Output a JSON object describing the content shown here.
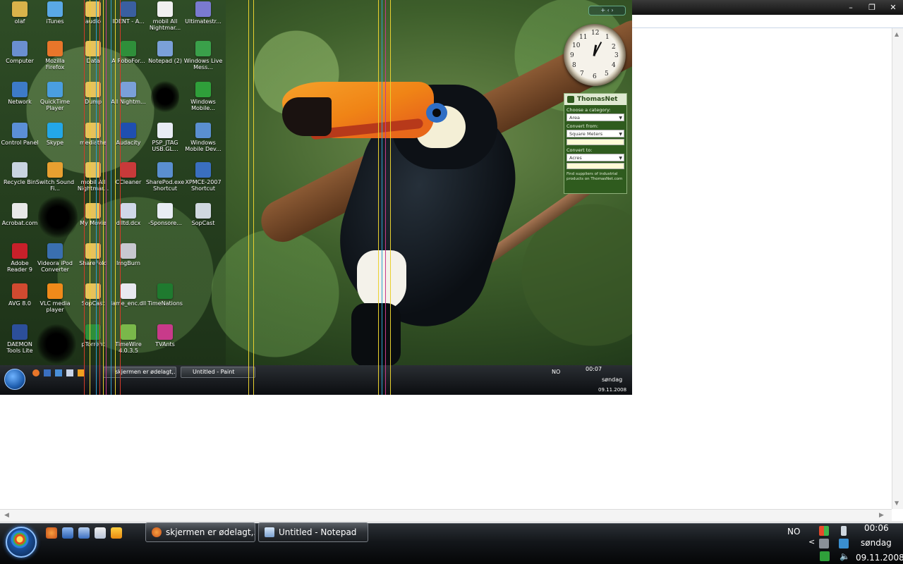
{
  "window": {
    "minimize": "–",
    "maximize": "❐",
    "close": "✕"
  },
  "scrollbars": {
    "up": "▲",
    "down": "▼",
    "left": "◀",
    "right": "▶"
  },
  "screenshot": {
    "icons": [
      {
        "label": "olaf",
        "color": "#d9b34a"
      },
      {
        "label": "iTunes",
        "color": "#5aa9e6"
      },
      {
        "label": "Computer",
        "color": "#6a8fd0"
      },
      {
        "label": "Mozilla Firefox",
        "color": "#e8762a"
      },
      {
        "label": "Network",
        "color": "#3d7bc8"
      },
      {
        "label": "QuickTime Player",
        "color": "#4a9ee0"
      },
      {
        "label": "Control Panel",
        "color": "#5b8fd6"
      },
      {
        "label": "Skype",
        "color": "#23a7e8"
      },
      {
        "label": "Recycle Bin",
        "color": "#c8d4e0"
      },
      {
        "label": "Switch Sound Fi...",
        "color": "#e8a030"
      },
      {
        "label": "Acrobat.com",
        "color": "#e8e8e8"
      },
      {
        "label": "Adobe Reader 9",
        "color": "#c8202a"
      },
      {
        "label": "Videora iPod Converter",
        "color": "#3a6fb0"
      },
      {
        "label": "AVG 8.0",
        "color": "#d04a30"
      },
      {
        "label": "VLC media player",
        "color": "#f08a1a"
      },
      {
        "label": "DAEMON Tools Lite",
        "color": "#2c4f9a"
      },
      {
        "label": "audio",
        "color": "#e8c25a"
      },
      {
        "label": "Data",
        "color": "#e8c25a"
      },
      {
        "label": "Dump",
        "color": "#e8c25a"
      },
      {
        "label": "mediathe",
        "color": "#e8c25a"
      },
      {
        "label": "mobil All Nightmar...",
        "color": "#e8c25a"
      },
      {
        "label": "My Movie",
        "color": "#e8c25a"
      },
      {
        "label": "ShareFold",
        "color": "#e8c25a"
      },
      {
        "label": "SopCast",
        "color": "#e8c25a"
      },
      {
        "label": "pTorrent",
        "color": "#2f8f3a"
      },
      {
        "label": "IDENT - A...",
        "color": "#3a5fa0"
      },
      {
        "label": "A RoboFor...",
        "color": "#2f8f3a"
      },
      {
        "label": "All Nightm...",
        "color": "#7aa0d8"
      },
      {
        "label": "Audacity",
        "color": "#1f4fb0"
      },
      {
        "label": "CCleaner",
        "color": "#c83a3a"
      },
      {
        "label": "dlltd.dcx",
        "color": "#d0d8e8"
      },
      {
        "label": "ImgBurn",
        "color": "#c8c8d0"
      },
      {
        "label": "lame_enc.dll",
        "color": "#e8e8f0"
      },
      {
        "label": "TimeWire 4.0.3.5",
        "color": "#7ab84a"
      },
      {
        "label": "mobil All Nightmar...",
        "color": "#f0f0f0"
      },
      {
        "label": "Notepad (2)",
        "color": "#7aa0d8"
      },
      {
        "label": "PSP_JTAG USB.GL...",
        "color": "#e8ecf4"
      },
      {
        "label": "SharePod.exe Shortcut",
        "color": "#5a8fd0"
      },
      {
        "label": "SopCast",
        "color": "#d0d8e0"
      },
      {
        "label": "-Sponsore...",
        "color": "#e8ecf4"
      },
      {
        "label": "TimeNations",
        "color": "#1f7a2f"
      },
      {
        "label": "TVAnts",
        "color": "#c83a8a"
      },
      {
        "label": "Ultimatestr...",
        "color": "#7a7ad0"
      },
      {
        "label": "Windows Live Mess...",
        "color": "#3aa04a"
      },
      {
        "label": "Windows Mobile...",
        "color": "#2f9f3a"
      },
      {
        "label": "Windows Mobile Dev...",
        "color": "#5a8fd0"
      },
      {
        "label": "XPMCE-2007 Shortcut",
        "color": "#3a6fc0"
      }
    ],
    "taskbar": {
      "tasks": [
        "skjermen er ødelagt,...",
        "Untitled - Paint"
      ],
      "lang": "NO",
      "time": "00:07",
      "day": "søndag",
      "date": "09.11.2008"
    },
    "gadget_bar": "+ ‹ ›",
    "clock": {
      "numbers": [
        "12",
        "1",
        "2",
        "3",
        "4",
        "5",
        "6",
        "7",
        "8",
        "9",
        "10",
        "11"
      ]
    },
    "converter": {
      "title": "ThomasNet",
      "category_label": "Choose a category:",
      "category_value": "Area",
      "from_label": "Convert from:",
      "from_value": "Square Meters",
      "to_label": "Convert to:",
      "to_value": "Acres",
      "footer": "Find suppliers of industrial products on ThomasNet.com"
    }
  },
  "taskbar": {
    "tasks": [
      {
        "label": "skjermen er ødelagt,...",
        "icon": "firefox-icon"
      },
      {
        "label": "Untitled - Notepad",
        "icon": "notepad-icon"
      }
    ],
    "lang": "NO",
    "time": "00:06",
    "day": "søndag",
    "date": "09.11.2008"
  }
}
